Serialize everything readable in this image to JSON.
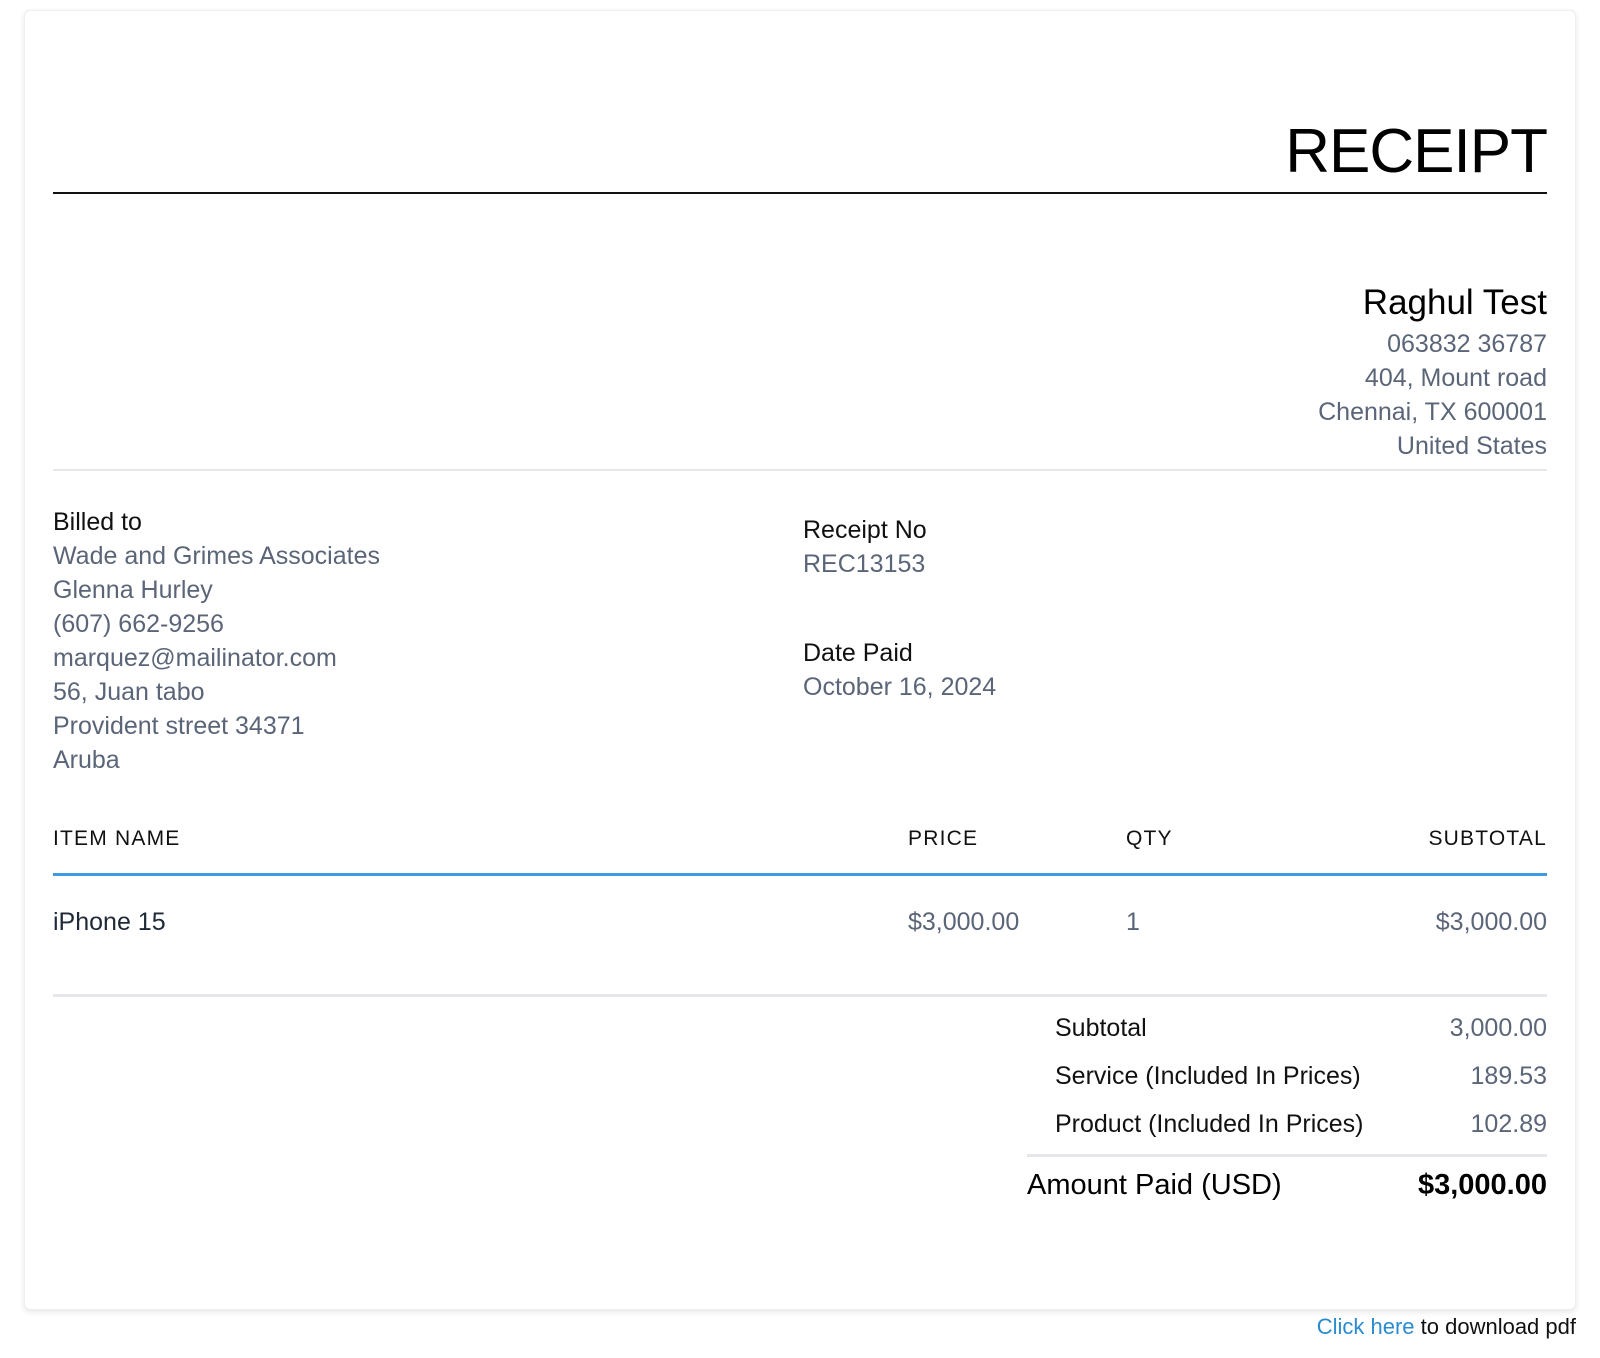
{
  "receipt": {
    "title": "RECEIPT"
  },
  "company": {
    "name": "Raghul Test",
    "phone": "063832 36787",
    "address_line1": "404, Mount road",
    "address_line2": "Chennai, TX 600001",
    "country": "United States"
  },
  "billed_to": {
    "label": "Billed to",
    "lines": [
      "Wade and Grimes Associates",
      "Glenna Hurley",
      "(607) 662-9256",
      "marquez@mailinator.com",
      "56, Juan tabo",
      "Provident street 34371",
      "Aruba"
    ]
  },
  "meta": {
    "receipt_no_label": "Receipt No",
    "receipt_no": "REC13153",
    "date_paid_label": "Date Paid",
    "date_paid": "October 16, 2024"
  },
  "table": {
    "headers": [
      "ITEM NAME",
      "PRICE",
      "QTY",
      "SUBTOTAL"
    ],
    "rows": [
      {
        "item": "iPhone 15",
        "price": "$3,000.00",
        "qty": "1",
        "subtotal": "$3,000.00"
      }
    ]
  },
  "totals": {
    "subtotal_label": "Subtotal",
    "subtotal": "3,000.00",
    "service_label": "Service (Included In Prices)",
    "service": "189.53",
    "product_label": "Product (Included In Prices)",
    "product": "102.89",
    "amount_paid_label": "Amount Paid (USD)",
    "amount_paid": "$3,000.00"
  },
  "footer": {
    "link_text": "Click here",
    "rest_text": " to download pdf"
  },
  "colors": {
    "accent_rule": "#3b9ae1",
    "link": "#2a8bd0",
    "muted_text": "#5b6578"
  }
}
